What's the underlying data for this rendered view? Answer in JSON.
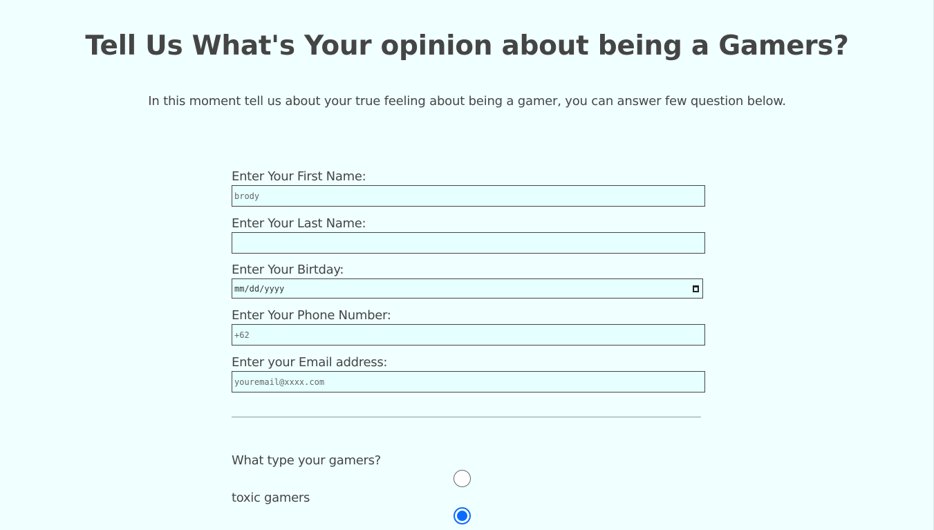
{
  "header": {
    "title": "Tell Us What's Your opinion about being a Gamers?",
    "subtitle": "In this moment tell us about your true feeling about being a gamer, you can answer few question below."
  },
  "form": {
    "first_name": {
      "label": "Enter Your First Name:",
      "placeholder": "brody"
    },
    "last_name": {
      "label": "Enter Your Last Name:",
      "placeholder": ""
    },
    "birthday": {
      "label": "Enter Your Birtday:",
      "placeholder": "mm/dd/yyyy"
    },
    "phone": {
      "label": "Enter Your Phone Number:",
      "placeholder": "+62"
    },
    "email": {
      "label": "Enter your Email address:",
      "placeholder": "youremail@xxxx.com"
    }
  },
  "question": {
    "label": "What type your gamers?",
    "options": [
      {
        "label": "toxic gamers",
        "checked": false
      },
      {
        "label": "",
        "checked": true
      }
    ]
  },
  "colors": {
    "background": "#f0ffff",
    "input_bg": "#e6ffff",
    "radio_accent": "#0a6cff"
  }
}
